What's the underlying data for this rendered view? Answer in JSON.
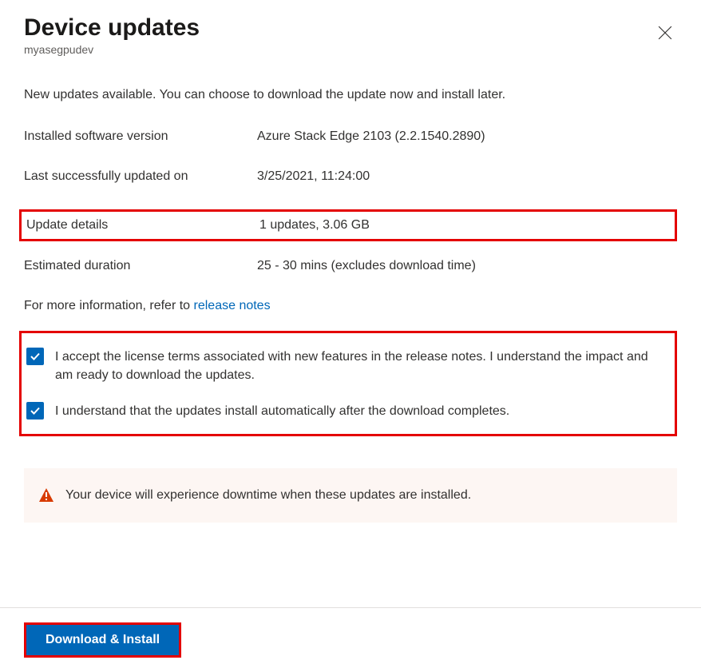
{
  "header": {
    "title": "Device updates",
    "subtitle": "myasegpudev"
  },
  "intro": "New updates available. You can choose to download the update now and install later.",
  "details": {
    "installed_label": "Installed software version",
    "installed_value": "Azure Stack Edge 2103 (2.2.1540.2890)",
    "last_updated_label": "Last successfully updated on",
    "last_updated_value": "3/25/2021, 11:24:00",
    "update_details_label": "Update details",
    "update_details_value": "1 updates, 3.06 GB",
    "duration_label": "Estimated duration",
    "duration_value": "25 - 30 mins (excludes download time)"
  },
  "more_info": {
    "prefix": "For more information, refer to ",
    "link_text": "release notes"
  },
  "checkboxes": {
    "accept": "I accept the license terms associated with new features in the release notes. I understand the impact and am ready to download the updates.",
    "understand": "I understand that the updates install automatically after the download completes."
  },
  "alert": "Your device will experience downtime when these updates are installed.",
  "footer": {
    "download_install": "Download & Install"
  }
}
